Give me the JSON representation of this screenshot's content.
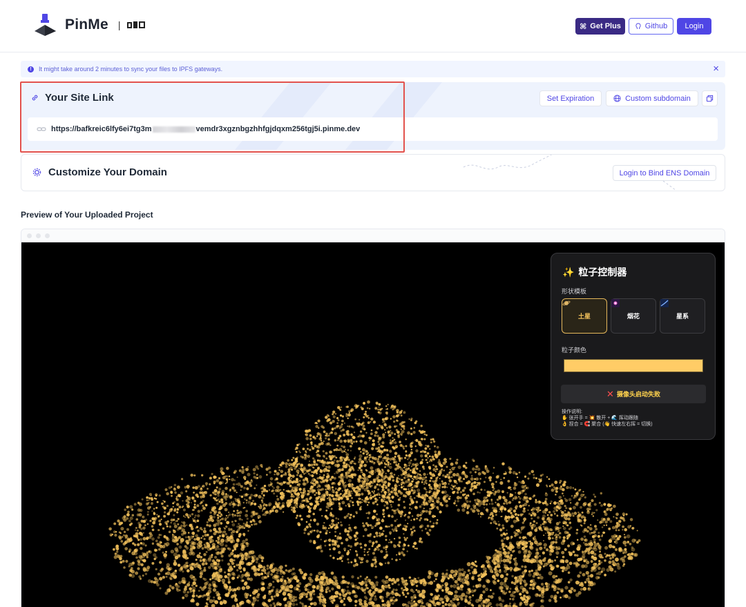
{
  "header": {
    "brand": "PinMe",
    "brand_sep": "|",
    "get_plus_label": "Get Plus",
    "github_label": "Github",
    "login_label": "Login"
  },
  "notice": {
    "text": "It might take around 2 minutes to sync your files to IPFS gateways."
  },
  "site_link": {
    "title": "Your Site Link",
    "url_prefix": "https://bafkreic6lfy6ei7tg3m",
    "url_suffix": "vemdr3xgznbgzhhfgjdqxm256tgj5i.pinme.dev",
    "set_expiration_label": "Set Expiration",
    "custom_subdomain_label": "Custom subdomain"
  },
  "customize": {
    "title": "Customize Your Domain",
    "ens_button_label": "Login to Bind ENS Domain"
  },
  "preview": {
    "label": "Preview of Your Uploaded Project"
  },
  "panel": {
    "title": "粒子控制器",
    "shape_heading": "形状模板",
    "shapes": [
      {
        "label": "土星",
        "icon": "saturn-icon"
      },
      {
        "label": "烟花",
        "icon": "firework-icon"
      },
      {
        "label": "星系",
        "icon": "galaxy-icon"
      }
    ],
    "color_heading": "粒子颜色",
    "particle_color": "#ffcc66",
    "camera_status": "摄像头启动失败",
    "help_title": "操作说明:",
    "help_line1": "✋ 张开手 = 💥 散开 + 🌊 挥动跟随",
    "help_line2": "👌 捏合 = 🧲 聚合 (👋 快速左右挥 = 切换)"
  },
  "colors": {
    "accent": "#4f46e5",
    "plus_bg": "#3a2a84",
    "highlight_border": "#e2514c",
    "particle_gold": "#f2c15b"
  }
}
